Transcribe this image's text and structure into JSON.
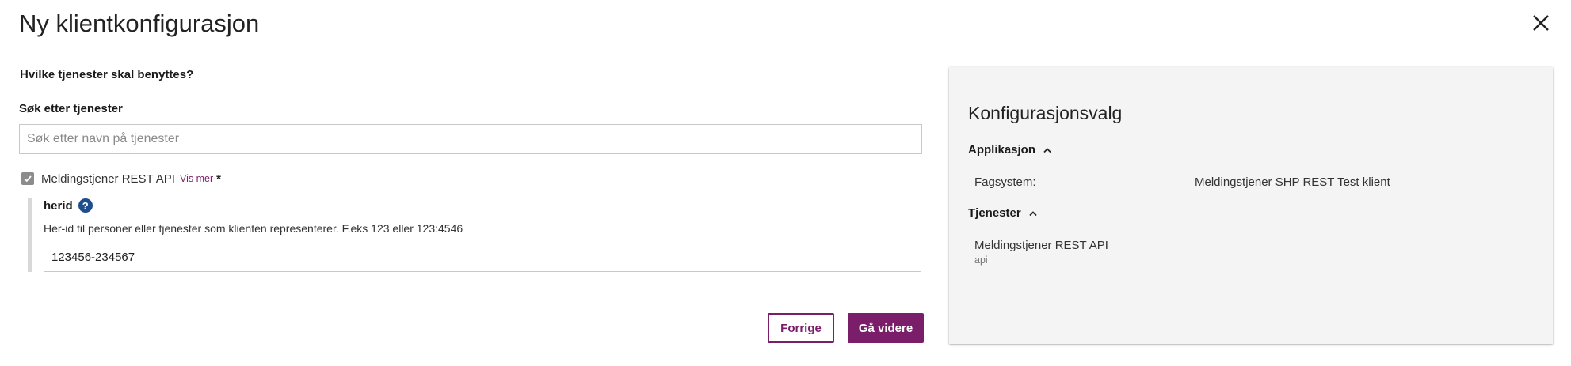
{
  "dialog": {
    "title": "Ny klientkonfigurasjon",
    "close_icon": "close-icon"
  },
  "form": {
    "question": "Hvilke tjenester skal benyttes?",
    "search_label": "Søk etter tjenester",
    "search_placeholder": "Søk etter navn på tjenester",
    "search_value": "",
    "service": {
      "checked": true,
      "label": "Meldingstjener REST API",
      "vis_mer": "Vis mer",
      "required_mark": "*"
    },
    "herid": {
      "label": "herid",
      "help_glyph": "?",
      "description": "Her-id til personer eller tjenester som klienten representerer. F.eks 123 eller 123:4546",
      "value": "123456-234567"
    },
    "buttons": {
      "previous": "Forrige",
      "next": "Gå videre"
    }
  },
  "summary": {
    "title": "Konfigurasjonsvalg",
    "sections": {
      "application": {
        "label": "Applikasjon",
        "expanded": true,
        "key": "Fagsystem:",
        "value": "Meldingstjener SHP REST Test klient"
      },
      "services": {
        "label": "Tjenester",
        "expanded": true,
        "name": "Meldingstjener REST API",
        "sub": "api"
      }
    }
  },
  "colors": {
    "accent": "#7b1e6a",
    "help_icon": "#1f4e8c",
    "panel_bg": "#f4f4f4"
  }
}
